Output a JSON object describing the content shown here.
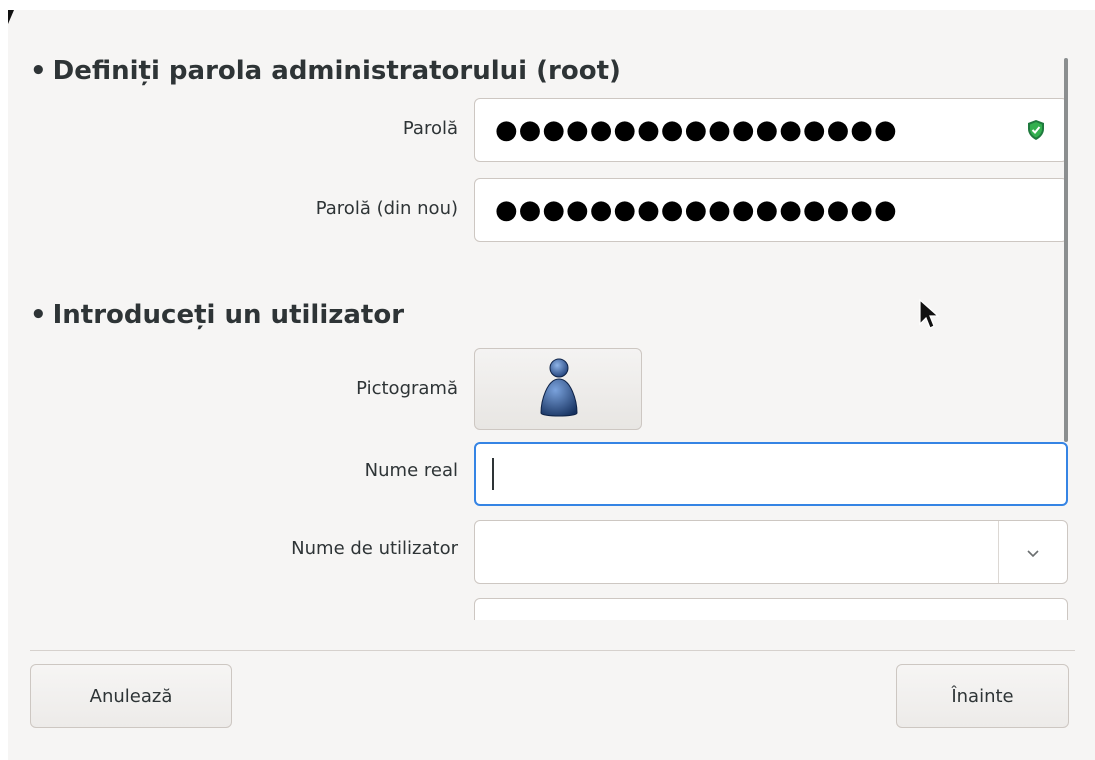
{
  "root_section": {
    "title": "Definiți parola administratorului (root)",
    "password_label": "Parolă",
    "password_value": "●●●●●●●●●●●●●●●●●",
    "password_again_label": "Parolă (din nou)",
    "password_again_value": "●●●●●●●●●●●●●●●●●",
    "strength_icon": "shield-check-icon",
    "strength_color": "#26a269"
  },
  "user_section": {
    "title": "Introduceți un utilizator",
    "icon_label": "Pictogramă",
    "icon_name": "user-avatar-icon",
    "real_name_label": "Nume real",
    "real_name_value": "",
    "username_label": "Nume de utilizator",
    "username_value": ""
  },
  "footer": {
    "cancel_label": "Anulează",
    "next_label": "Înainte"
  },
  "colors": {
    "focus_border": "#3584e4",
    "window_bg": "#f6f5f4"
  }
}
